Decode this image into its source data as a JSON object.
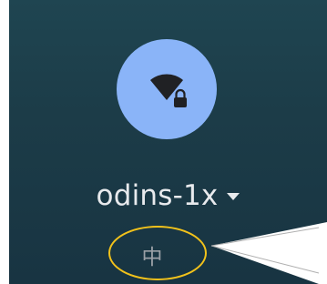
{
  "network": {
    "name": "odins-1x",
    "icon": "wifi-locked-icon",
    "dropdown_icon": "caret-down-icon"
  },
  "ime": {
    "label": "中"
  },
  "colors": {
    "background": "#1c3c48",
    "wifi_circle": "#8ab4f8",
    "highlight_ring": "#f2c21b",
    "callout": "#ffffff"
  }
}
